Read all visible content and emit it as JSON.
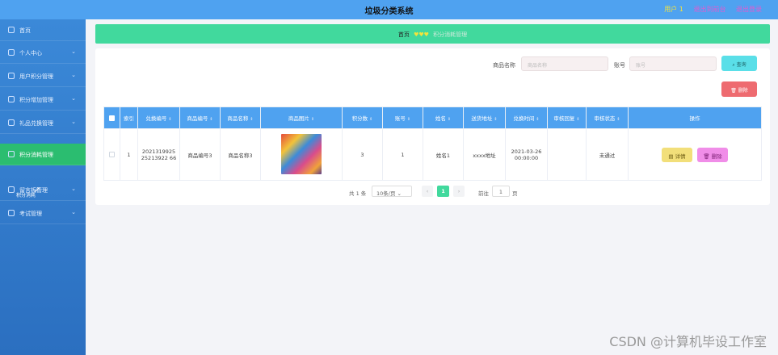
{
  "app": {
    "title": "垃圾分类系统"
  },
  "header": {
    "user": "用户 1",
    "link_front": "退出到前台",
    "link_logout": "退出登录"
  },
  "sidebar": {
    "items": [
      {
        "label": "首页"
      },
      {
        "label": "个人中心"
      },
      {
        "label": "用户积分管理"
      },
      {
        "label": "积分增加管理"
      },
      {
        "label": "礼品兑换管理"
      },
      {
        "label": "积分消耗管理"
      },
      {
        "label": "留言板管理"
      },
      {
        "label": "考试管理"
      }
    ],
    "subitem": "积分消耗"
  },
  "breadcrumb": {
    "home": "首页",
    "separator": "♥♥♥",
    "current": "积分消耗管理"
  },
  "search": {
    "name_label": "商品名称",
    "name_placeholder": "商品名称",
    "account_label": "账号",
    "account_placeholder": "账号",
    "query_button": "查询",
    "delete_button": "删除"
  },
  "table": {
    "headers": [
      "索引",
      "兑换编号",
      "商品编号",
      "商品名称",
      "商品图片",
      "积分数",
      "账号",
      "姓名",
      "送货地址",
      "兑换时间",
      "审核回复",
      "审核状态",
      "操作"
    ],
    "rows": [
      {
        "index": "1",
        "exchange_no": "202131992525213922 66",
        "product_no": "商品编号3",
        "product_name": "商品名称3",
        "points": "3",
        "account": "1",
        "name": "姓名1",
        "address": "xxxx地址",
        "time": "2021-03-26 00:00:00",
        "reply": "",
        "status": "未通过",
        "detail_btn": "详情",
        "delete_btn": "删除"
      }
    ]
  },
  "pagination": {
    "total": "共 1 条",
    "page_size": "10条/页",
    "current_page": "1",
    "goto_label": "前往",
    "goto_value": "1",
    "page_suffix": "页"
  },
  "watermark": "CSDN @计算机毕设工作室"
}
